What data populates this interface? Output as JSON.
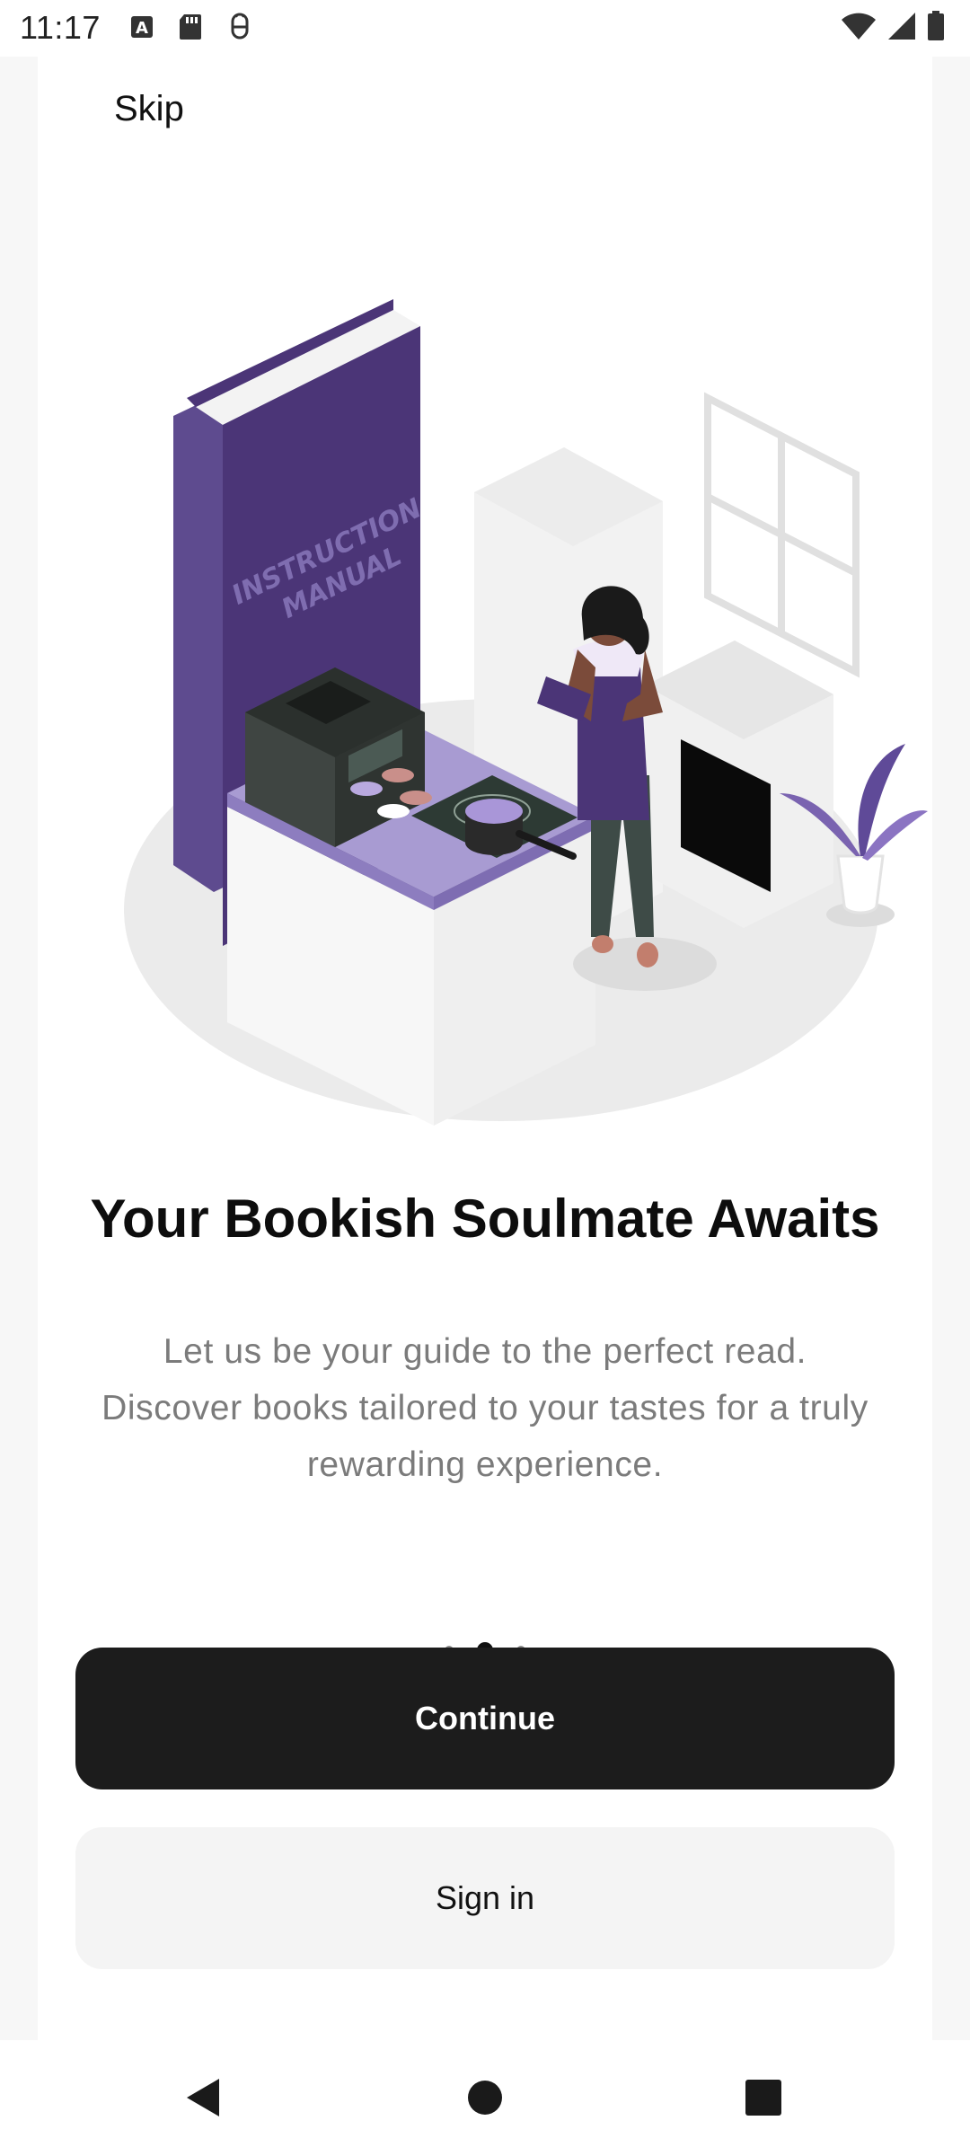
{
  "status_bar": {
    "time": "11:17",
    "left_icons": [
      "font-notification-icon",
      "sd-card-icon",
      "usb-debug-icon"
    ],
    "right_icons": [
      "wifi-icon",
      "signal-icon",
      "battery-icon"
    ]
  },
  "onboarding": {
    "skip_label": "Skip",
    "illustration_text": "INSTRUCTION MANUAL",
    "title": "Your Bookish Soulmate Awaits",
    "subtitle": "Let us be your guide to the perfect read. Discover books tailored to your tastes for a truly rewarding experience.",
    "page_indicator": {
      "total": 3,
      "current": 2
    },
    "primary_button": "Continue",
    "secondary_button": "Sign in"
  },
  "navigation_bar": {
    "buttons": [
      "back-icon",
      "home-icon",
      "recents-icon"
    ]
  },
  "colors": {
    "accent_purple": "#4b3577",
    "primary_button_bg": "#1c1c1c",
    "secondary_button_bg": "#f4f4f4",
    "subtitle_text": "#7b7b7b"
  }
}
